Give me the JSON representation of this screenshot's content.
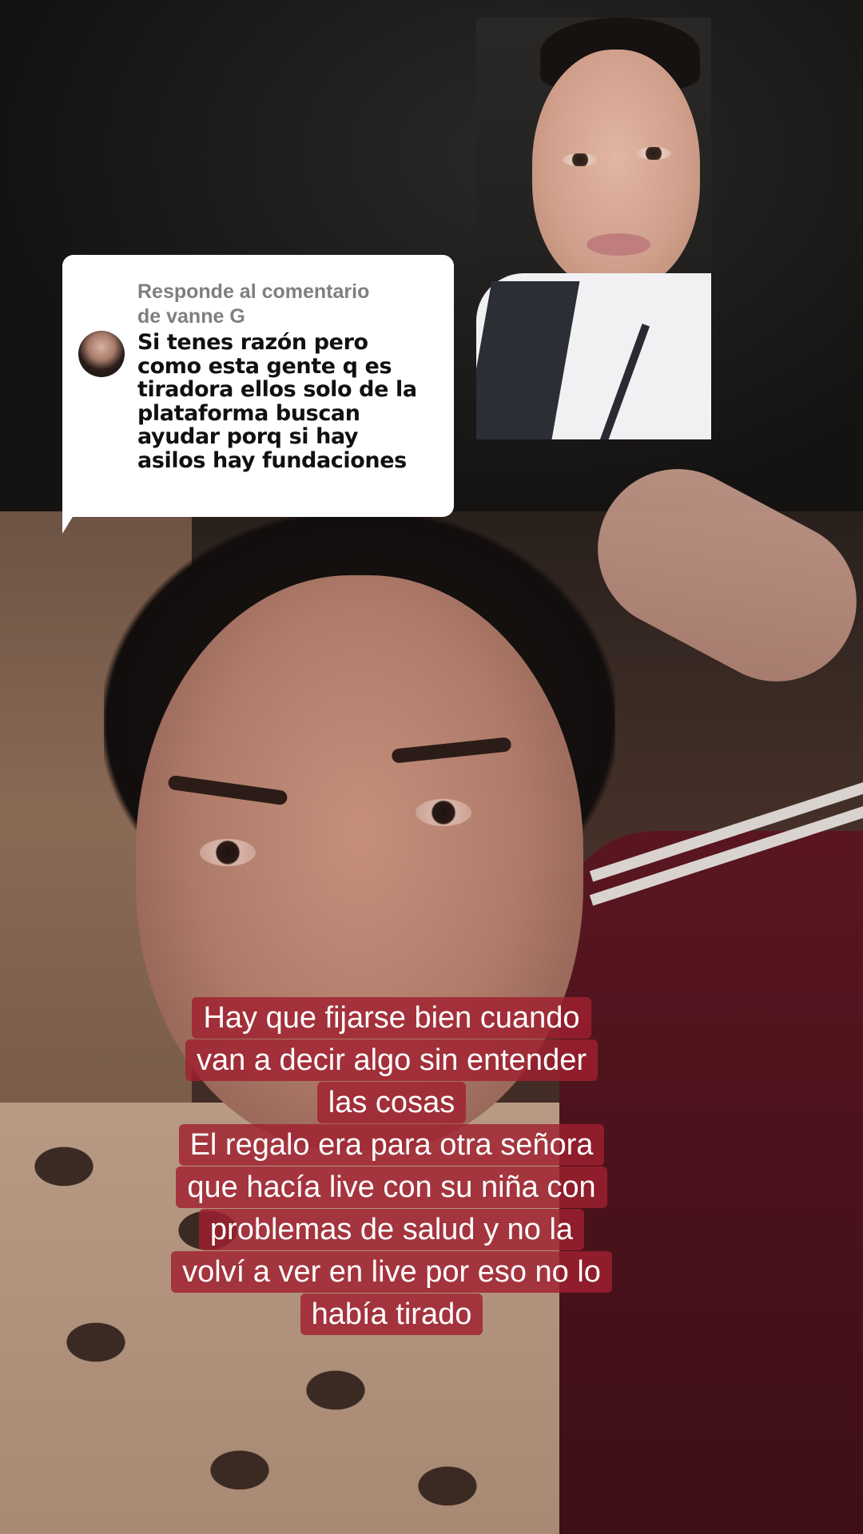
{
  "reply": {
    "header_line1": "Responde al comentario",
    "header_line2": "de vanne G",
    "body_lines": [
      "Si tenes razón pero",
      "como esta gente q es",
      "tiradora ellos solo de la",
      "plataforma buscan",
      "ayudar porq si hay",
      "asilos hay fundaciones"
    ]
  },
  "caption": {
    "lines": [
      "Hay que fijarse bien cuando",
      "van a decir algo sin entender",
      "las cosas",
      "El regalo era para otra señora",
      "que hacía live con su niña con",
      "problemas de salud y no la",
      "volví a ver en live por eso no lo",
      "había tirado"
    ]
  },
  "colors": {
    "caption_background": "#a02030",
    "bubble_background": "#ffffff",
    "header_text": "#7f7f7f",
    "body_text": "#101010"
  }
}
